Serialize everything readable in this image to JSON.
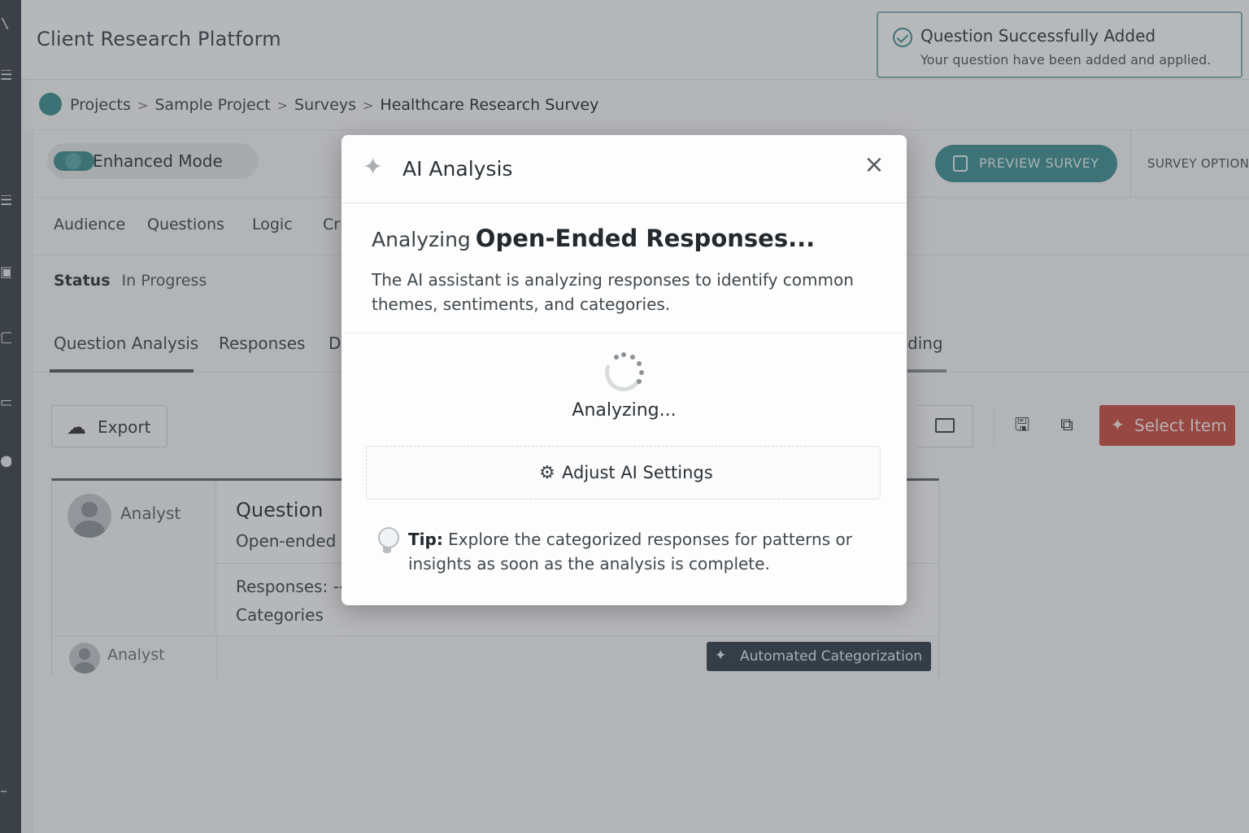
{
  "app": {
    "title": "Client Research Platform"
  },
  "toast": {
    "title": "Question Successfully Added",
    "message": "Your question have been added and applied."
  },
  "breadcrumb": {
    "items": [
      "Projects",
      "Sample Project",
      "Surveys",
      "Healthcare Research Survey"
    ],
    "separator": ">"
  },
  "toolbar": {
    "enhanced_mode": "Enhanced Mode",
    "preview_survey": "PREVIEW SURVEY",
    "survey_options": "SURVEY OPTION"
  },
  "nav_tabs": [
    "Audience",
    "Questions",
    "Logic",
    "Cr"
  ],
  "status": {
    "label": "Status",
    "value": "In Progress"
  },
  "sub_tabs": {
    "items": [
      "Question Analysis",
      "Responses",
      "D",
      "ding"
    ],
    "active": "Question Analysis"
  },
  "actions": {
    "export": "Export",
    "select_item": "Select Item"
  },
  "card": {
    "author": "Analyst",
    "question_title": "Question",
    "question_type": "Open-ended r",
    "responses": "Responses: --",
    "categories": "Categories",
    "footer_author": "Analyst",
    "automated_categorization": "Automated Categorization"
  },
  "modal": {
    "title": "AI Analysis",
    "heading_prefix": "Analyzing",
    "heading_main": "Open-Ended Responses...",
    "description": "The AI assistant is analyzing responses to identify common themes, sentiments, and categories.",
    "status": "Analyzing...",
    "adjust_button": "Adjust AI Settings",
    "tip_label": "Tip:",
    "tip_text": "Explore the categorized responses for patterns or insights as soon as the analysis is complete."
  },
  "colors": {
    "accent": "#3e9094",
    "danger": "#cc4e41",
    "dark_button": "#2f3e48"
  }
}
